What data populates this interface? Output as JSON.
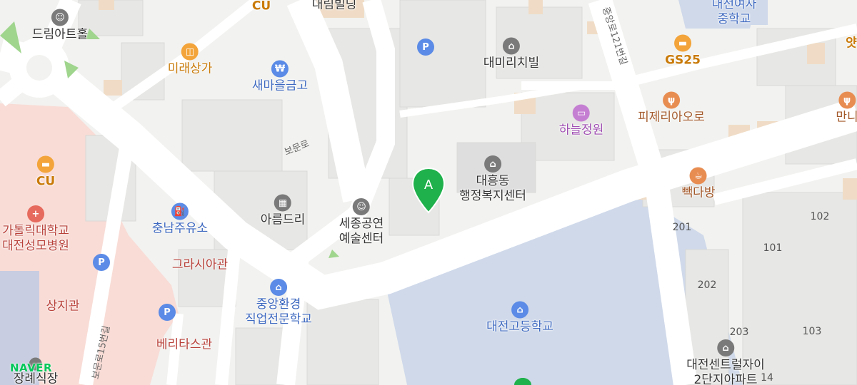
{
  "marker": {
    "label": "A",
    "color": "#1fb14b"
  },
  "brand": {
    "text": "NAVER",
    "color": "#03c75a"
  },
  "colors": {
    "orange": "#f3a43a",
    "blue": "#5b8be6",
    "gray": "#7a7a7a",
    "purple": "#c57fd2",
    "brown": "#b07a47",
    "red": "#e66a5d"
  },
  "pois": [
    {
      "id": "dream-art-hall",
      "icon": "theater-mask-icon",
      "label": "드림아트홀",
      "color": "gray"
    },
    {
      "id": "cu-top",
      "icon": "convenience-store-icon",
      "label": "CU",
      "color": "orange"
    },
    {
      "id": "daerim-building",
      "icon": "building-icon",
      "label": "대림빌딩",
      "color": "gray"
    },
    {
      "id": "parking-top",
      "icon": "parking-icon",
      "label": "",
      "color": "blue"
    },
    {
      "id": "daemiri-chibil",
      "icon": "building-icon",
      "label": "대미리치빌",
      "color": "gray"
    },
    {
      "id": "daejeon-girls-middle",
      "icon": "school-icon",
      "label": "대전여자\n중학교",
      "color": "blue"
    },
    {
      "id": "gs25",
      "icon": "convenience-store-icon",
      "label": "GS25",
      "color": "orange"
    },
    {
      "id": "mirae-sangga",
      "icon": "shopping-bag-icon",
      "label": "미래상가",
      "color": "orange"
    },
    {
      "id": "saemaeul-geumgo",
      "icon": "bank-icon",
      "label": "새마을금고",
      "color": "blue"
    },
    {
      "id": "pizzeria-oro",
      "icon": "restaurant-icon",
      "label": "피제리아오로",
      "color": "brown"
    },
    {
      "id": "manni-partial",
      "icon": "restaurant-icon",
      "label": "만니",
      "color": "brown"
    },
    {
      "id": "haneul-jeongwon",
      "icon": "hotel-icon",
      "label": "하늘정원",
      "color": "purple"
    },
    {
      "id": "cu-left",
      "icon": "convenience-store-icon",
      "label": "CU",
      "color": "orange"
    },
    {
      "id": "daeheung-welfare",
      "icon": "government-icon",
      "label": "대흥동\n행정복지센터",
      "color": "gray"
    },
    {
      "id": "ppakdabang",
      "icon": "cafe-icon",
      "label": "빽다방",
      "color": "brown"
    },
    {
      "id": "catholic-hospital",
      "icon": "hospital-icon",
      "label": "가톨릭대학교\n대전성모병원",
      "color": "red"
    },
    {
      "id": "chungnam-gas",
      "icon": "gas-station-icon",
      "label": "충남주유소",
      "color": "blue"
    },
    {
      "id": "areumdeuri",
      "icon": "apartment-icon",
      "label": "아름드리",
      "color": "gray"
    },
    {
      "id": "sejong-arts-center",
      "icon": "theater-mask-icon",
      "label": "세종공연\n예술센터",
      "color": "gray"
    },
    {
      "id": "parking-left",
      "icon": "parking-icon",
      "label": "",
      "color": "blue"
    },
    {
      "id": "gracia-gwan",
      "icon": "",
      "label": "그라시아관",
      "color": "red"
    },
    {
      "id": "sangji-gwan",
      "icon": "",
      "label": "상지관",
      "color": "red"
    },
    {
      "id": "jungang-env-school",
      "icon": "school-icon",
      "label": "중앙환경\n직업전문학교",
      "color": "blue"
    },
    {
      "id": "parking-bottom",
      "icon": "parking-icon",
      "label": "",
      "color": "blue"
    },
    {
      "id": "veritas-gwan",
      "icon": "",
      "label": "베리타스관",
      "color": "red"
    },
    {
      "id": "daejeon-high",
      "icon": "school-icon",
      "label": "대전고등학교",
      "color": "blue"
    },
    {
      "id": "daejeon-central-xi",
      "icon": "apartment-icon",
      "label": "대전센트럴자이\n2단지아파트",
      "color": "gray"
    },
    {
      "id": "funeral-hall",
      "icon": "funeral-icon",
      "label": "장례식장",
      "color": "gray"
    },
    {
      "id": "yat-partial",
      "icon": "",
      "label": "얏",
      "color": "orange"
    }
  ],
  "roads": [
    {
      "id": "bomun-ro",
      "label": "보문로"
    },
    {
      "id": "jungang-ro-121",
      "label": "중앙로121번길"
    },
    {
      "id": "bomun-ro-15",
      "label": "보문로15번길"
    }
  ],
  "building_numbers": [
    "102",
    "101",
    "201",
    "202",
    "203",
    "103",
    "14"
  ]
}
